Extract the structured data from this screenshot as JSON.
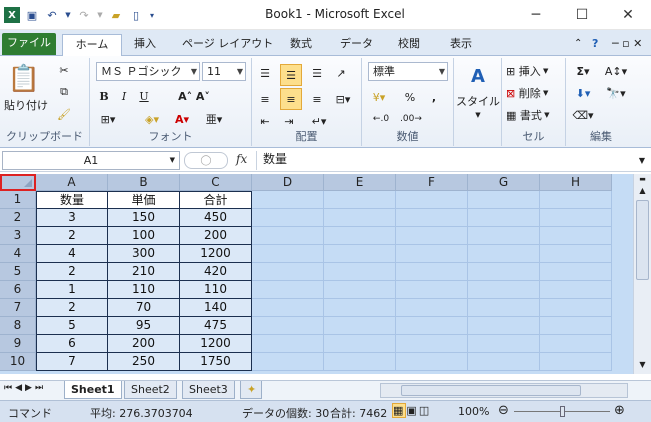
{
  "app": {
    "title": "Book1 - Microsoft Excel",
    "icon": "excel-icon"
  },
  "quick_access": [
    "save-icon",
    "undo-icon",
    "redo-icon",
    "open-folder-icon",
    "new-file-icon"
  ],
  "ribbon_tabs": [
    "ファイル",
    "ホーム",
    "挿入",
    "ページ レイアウト",
    "数式",
    "データ",
    "校閲",
    "表示"
  ],
  "ribbon": {
    "clipboard": {
      "paste": "貼り付け",
      "name": "クリップボード"
    },
    "font": {
      "family": "ＭＳ Ｐゴシック",
      "size": "11",
      "name": "フォント",
      "bold": "B",
      "italic": "I",
      "underline": "U"
    },
    "alignment": {
      "name": "配置"
    },
    "number": {
      "format": "標準",
      "name": "数値",
      "percent": "%",
      "comma": ","
    },
    "style": {
      "label": "スタイル"
    },
    "cells": {
      "insert": "挿入",
      "delete": "削除",
      "format": "書式",
      "name": "セル"
    },
    "editing": {
      "name": "編集",
      "sum": "Σ"
    }
  },
  "formula_bar": {
    "name_box": "A1",
    "fx": "fx",
    "value": "数量"
  },
  "columns": [
    "A",
    "B",
    "C",
    "D",
    "E",
    "F",
    "G",
    "H"
  ],
  "rows": [
    "1",
    "2",
    "3",
    "4",
    "5",
    "6",
    "7",
    "8",
    "9",
    "10"
  ],
  "table": {
    "headers": [
      "数量",
      "単価",
      "合計"
    ],
    "rows": [
      [
        "3",
        "150",
        "450"
      ],
      [
        "2",
        "100",
        "200"
      ],
      [
        "4",
        "300",
        "1200"
      ],
      [
        "2",
        "210",
        "420"
      ],
      [
        "1",
        "110",
        "110"
      ],
      [
        "2",
        "70",
        "140"
      ],
      [
        "5",
        "95",
        "475"
      ],
      [
        "6",
        "200",
        "1200"
      ],
      [
        "7",
        "250",
        "1750"
      ]
    ]
  },
  "sheets": [
    "Sheet1",
    "Sheet2",
    "Sheet3"
  ],
  "status": {
    "mode": "コマンド",
    "average": "平均: 276.3703704",
    "count": "データの個数: 30",
    "sum": "合計: 7462",
    "zoom": "100%"
  },
  "colors": {
    "file_tab": "#2f7d32",
    "selection": "#c5dcf5",
    "header": "#b7c8e0"
  }
}
